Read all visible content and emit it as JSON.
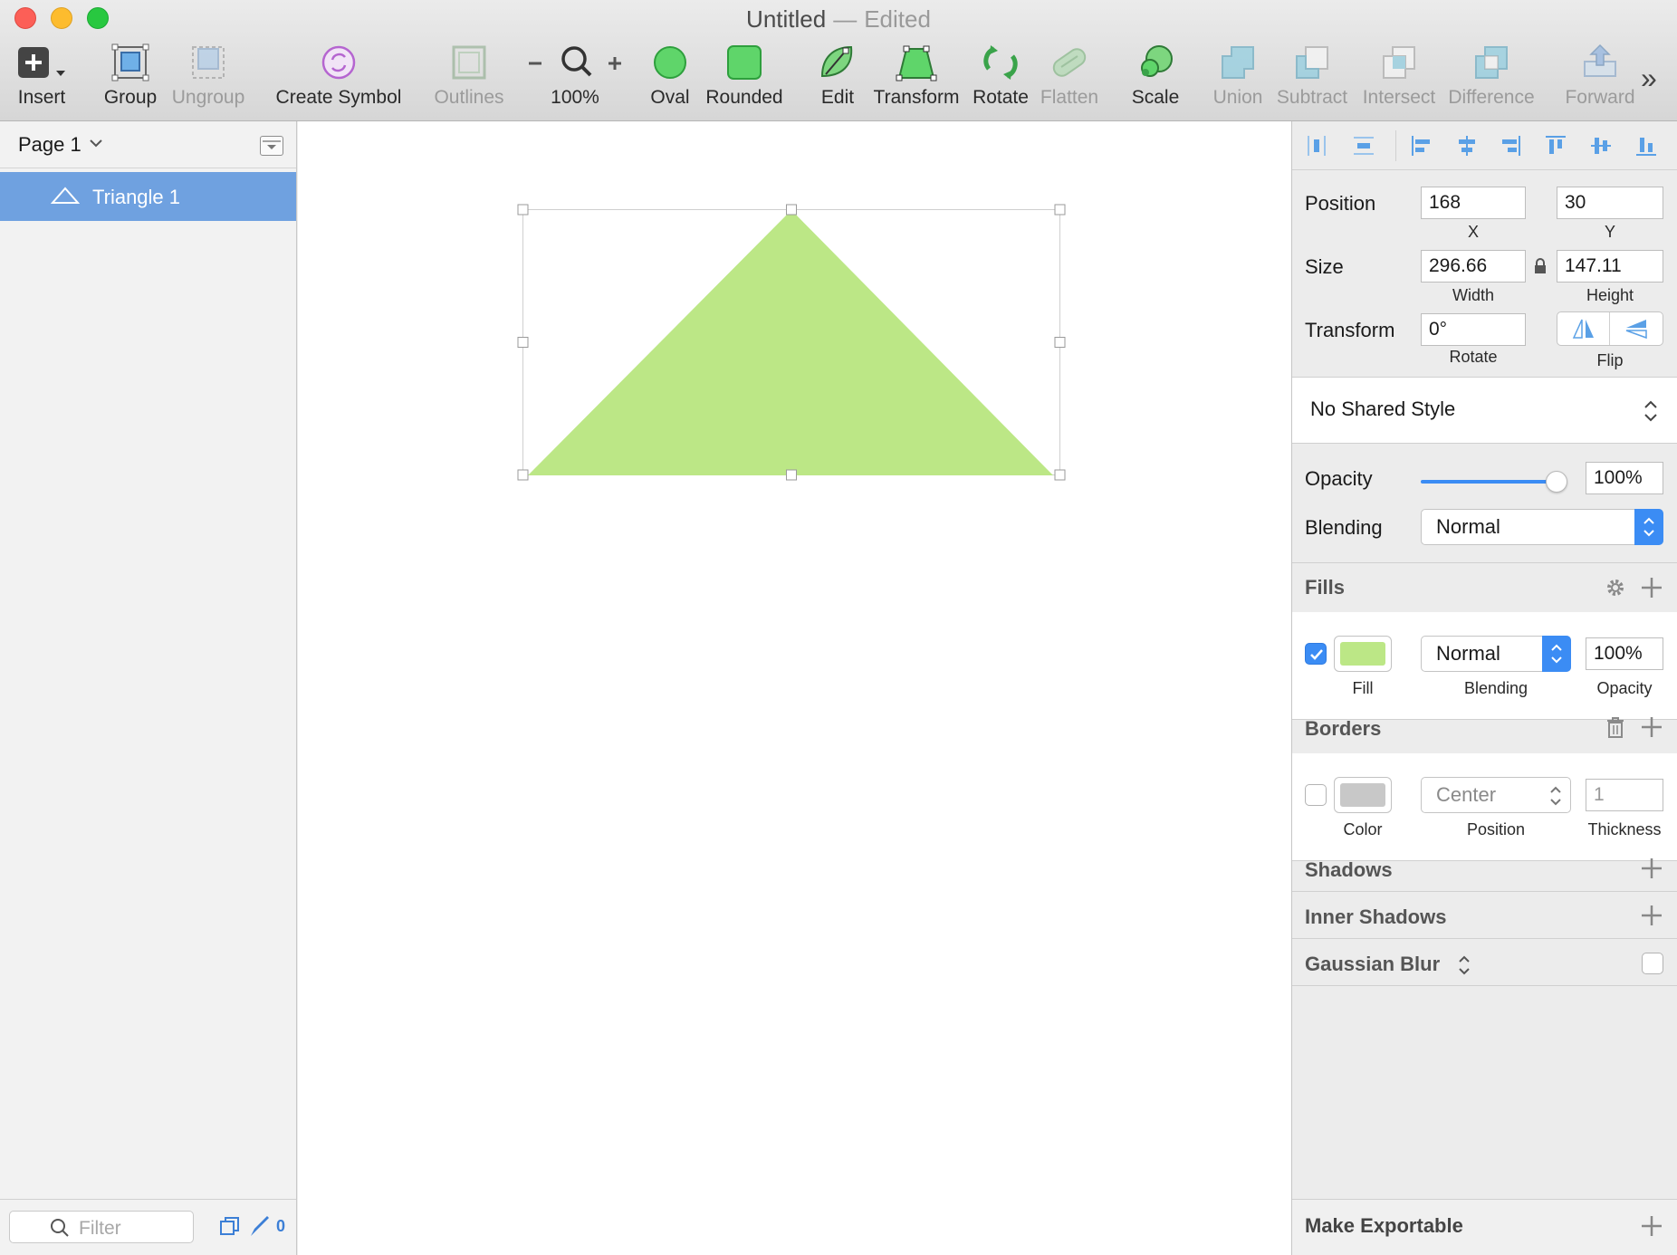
{
  "window": {
    "title": "Untitled",
    "separator": "—",
    "status": "Edited"
  },
  "toolbar": {
    "insert": "Insert",
    "group": "Group",
    "ungroup": "Ungroup",
    "create_symbol": "Create Symbol",
    "outlines": "Outlines",
    "zoom": "100%",
    "oval": "Oval",
    "rounded": "Rounded",
    "edit": "Edit",
    "transform": "Transform",
    "rotate": "Rotate",
    "flatten": "Flatten",
    "scale": "Scale",
    "union": "Union",
    "subtract": "Subtract",
    "intersect": "Intersect",
    "difference": "Difference",
    "forward": "Forward",
    "overflow": "»"
  },
  "layers": {
    "page_name": "Page 1",
    "items": [
      {
        "label": "Triangle 1",
        "selected": true
      }
    ],
    "filter_placeholder": "Filter",
    "slice_count": "0"
  },
  "canvas": {
    "shape_fill": "#bce786"
  },
  "inspector": {
    "position": {
      "label": "Position",
      "x": "168",
      "y": "30",
      "x_label": "X",
      "y_label": "Y"
    },
    "size": {
      "label": "Size",
      "width": "296.66",
      "height": "147.11",
      "width_label": "Width",
      "height_label": "Height"
    },
    "transform": {
      "label": "Transform",
      "rotate": "0°",
      "rotate_label": "Rotate",
      "flip_label": "Flip"
    },
    "shared_style": "No Shared Style",
    "opacity": {
      "label": "Opacity",
      "value": "100%",
      "level": 1.0
    },
    "blending": {
      "label": "Blending",
      "value": "Normal"
    },
    "fills": {
      "title": "Fills",
      "enabled": true,
      "color": "#bce786",
      "blending": "Normal",
      "opacity": "100%",
      "fill_label": "Fill",
      "blending_label": "Blending",
      "opacity_label": "Opacity"
    },
    "borders": {
      "title": "Borders",
      "enabled": false,
      "color": "#c8c8c8",
      "position": "Center",
      "thickness": "1",
      "color_label": "Color",
      "position_label": "Position",
      "thickness_label": "Thickness"
    },
    "shadows_title": "Shadows",
    "inner_shadows_title": "Inner Shadows",
    "gaussian_blur_title": "Gaussian Blur",
    "make_exportable": "Make Exportable"
  },
  "colors": {
    "accent": "#3b8cf4",
    "selection": "#6fa1e0"
  }
}
